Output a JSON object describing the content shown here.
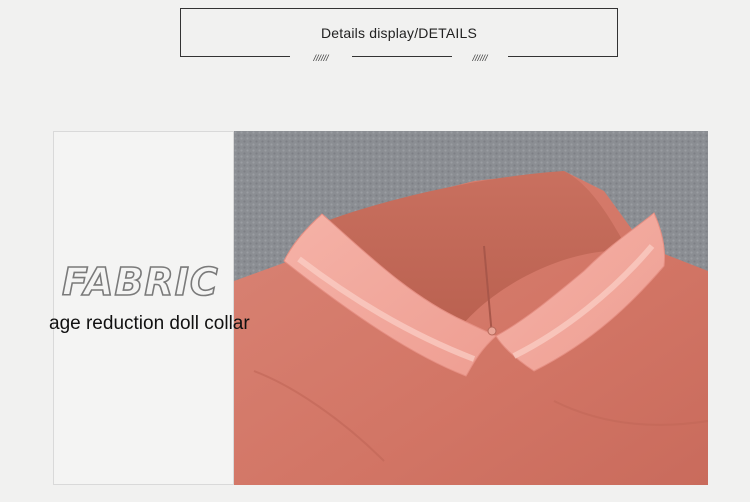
{
  "header": {
    "title": "Details display/DETAILS",
    "deco_left": "//////",
    "deco_right": "//////"
  },
  "feature": {
    "fabric_word": "FABRIC",
    "caption": "age reduction doll collar"
  },
  "colors": {
    "background": "#f1f1f0",
    "fabric": "#d5796a",
    "collar": "#f2a79c",
    "knit": "#8d9095"
  }
}
